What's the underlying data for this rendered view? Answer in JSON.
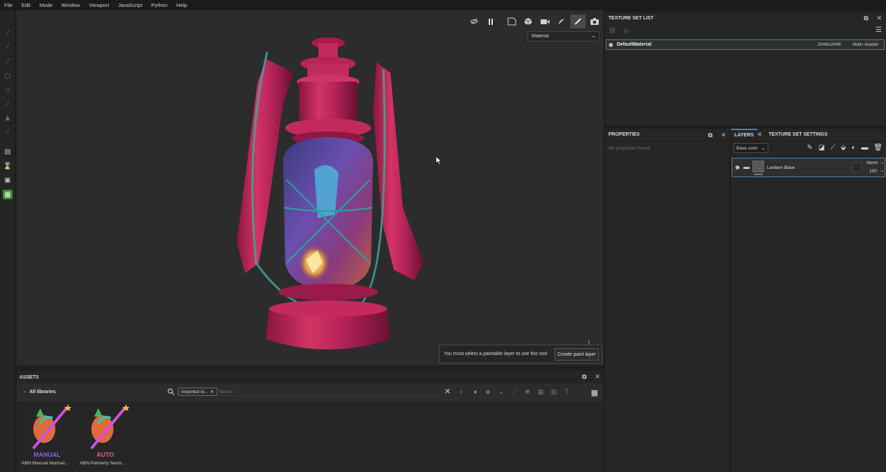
{
  "menu": [
    "File",
    "Edit",
    "Mode",
    "Window",
    "Viewport",
    "JavaScript",
    "Python",
    "Help"
  ],
  "viewport": {
    "channel_select": "Material",
    "notice_message": "You must select a paintable layer to use this tool",
    "notice_button": "Create paint layer",
    "axis_label": "Y"
  },
  "assets": {
    "title": "ASSETS",
    "libraries_label": "All libraries",
    "filter_chip": "Imported re...",
    "search_placeholder": "Search",
    "items": [
      {
        "name": "ABN Manual Normal...",
        "badge": "MANUAL"
      },
      {
        "name": "ABN Painterly Norm...",
        "badge": "AUTO"
      }
    ]
  },
  "texture_set_list": {
    "title": "TEXTURE SET LIST",
    "rows": [
      {
        "name": "DefaultMaterial",
        "resolution": "2048x2048",
        "shader": "Main shader"
      }
    ]
  },
  "properties": {
    "title": "PROPERTIES",
    "empty_text": "No properties found"
  },
  "layers": {
    "tab_layers": "LAYERS",
    "tab_settings": "TEXTURE SET SETTINGS",
    "channel": "Base color",
    "rows": [
      {
        "name": "Lantern Base",
        "blend": "Norm",
        "opacity": "100"
      }
    ]
  },
  "colors": {
    "accent_blue": "#4d80b0",
    "active_tool_green": "#3f8a3a"
  }
}
